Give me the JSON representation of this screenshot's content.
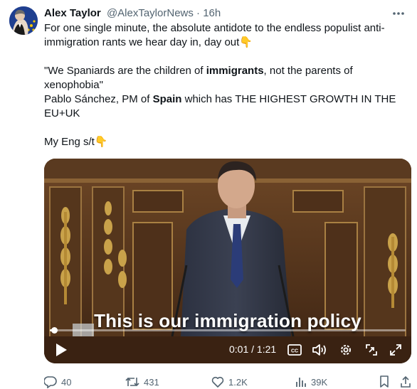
{
  "tweet": {
    "author_name": "Alex Taylor",
    "handle": "@AlexTaylorNews",
    "time": "16h",
    "separator": "·",
    "lines": {
      "line1": "For one single minute, the absolute antidote to the endless populist anti-",
      "line2": "immigration rants we hear day in, day out",
      "quote_a": "\"We Spaniards are the children of ",
      "quote_b": "immigrants",
      "quote_c": ", not the parents of",
      "quote_d": "xenophobia\"",
      "src_a": "Pablo Sánchez, PM of ",
      "src_b": "Spain",
      "src_c": " which has THE HIGHEST GROWTH IN THE",
      "src_d": "EU+UK",
      "note": "My Eng s/t"
    },
    "emoji": "pointing-down-hand"
  },
  "video": {
    "caption": "This is our immigration policy",
    "current_time": "0:01",
    "duration": "1:21",
    "time_sep": " / ",
    "progress": 0.012,
    "cc_label": "CC"
  },
  "actions": {
    "replies": "40",
    "retweets": "431",
    "likes": "1.2K",
    "views": "39K"
  },
  "colors": {
    "text": "#0f1419",
    "muted": "#536471",
    "flag_blue": "#1f3f8f",
    "flag_star": "#f2c500"
  }
}
